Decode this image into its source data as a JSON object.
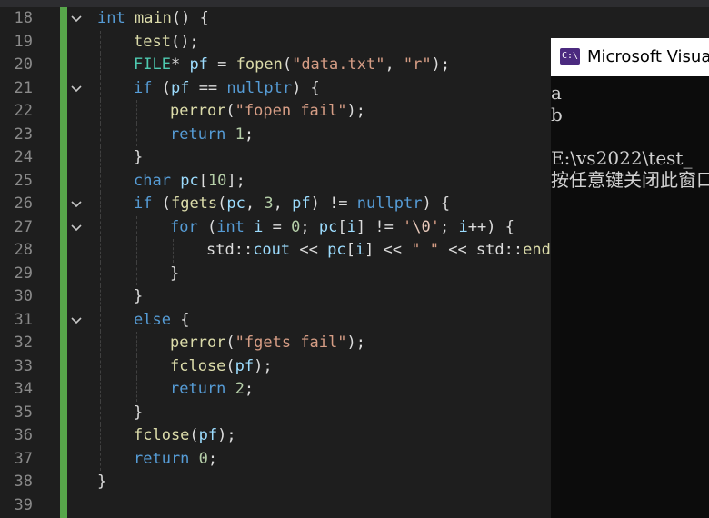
{
  "editor": {
    "lines": [
      {
        "n": "18",
        "indent": 0,
        "tokens": [
          [
            "kw",
            "int"
          ],
          [
            "t",
            " "
          ],
          [
            "fn",
            "main"
          ],
          [
            "t",
            "() {"
          ]
        ]
      },
      {
        "n": "19",
        "indent": 1,
        "tokens": [
          [
            "fn",
            "test"
          ],
          [
            "t",
            "();"
          ]
        ]
      },
      {
        "n": "20",
        "indent": 1,
        "tokens": [
          [
            "ty",
            "FILE"
          ],
          [
            "t",
            "* "
          ],
          [
            "vr",
            "pf"
          ],
          [
            "t",
            " = "
          ],
          [
            "fn",
            "fopen"
          ],
          [
            "t",
            "("
          ],
          [
            "str",
            "\"data.txt\""
          ],
          [
            "t",
            ", "
          ],
          [
            "str",
            "\"r\""
          ],
          [
            "t",
            ");"
          ]
        ]
      },
      {
        "n": "21",
        "indent": 1,
        "tokens": [
          [
            "kw",
            "if"
          ],
          [
            "t",
            " ("
          ],
          [
            "vr",
            "pf"
          ],
          [
            "t",
            " == "
          ],
          [
            "kw",
            "nullptr"
          ],
          [
            "t",
            ") {"
          ]
        ]
      },
      {
        "n": "22",
        "indent": 2,
        "tokens": [
          [
            "fn",
            "perror"
          ],
          [
            "t",
            "("
          ],
          [
            "str",
            "\"fopen fail\""
          ],
          [
            "t",
            ");"
          ]
        ]
      },
      {
        "n": "23",
        "indent": 2,
        "tokens": [
          [
            "kw",
            "return"
          ],
          [
            "t",
            " "
          ],
          [
            "num",
            "1"
          ],
          [
            "t",
            ";"
          ]
        ]
      },
      {
        "n": "24",
        "indent": 1,
        "tokens": [
          [
            "t",
            "}"
          ]
        ]
      },
      {
        "n": "25",
        "indent": 1,
        "tokens": [
          [
            "kw",
            "char"
          ],
          [
            "t",
            " "
          ],
          [
            "vr",
            "pc"
          ],
          [
            "t",
            "["
          ],
          [
            "num",
            "10"
          ],
          [
            "t",
            "];"
          ]
        ]
      },
      {
        "n": "26",
        "indent": 1,
        "tokens": [
          [
            "kw",
            "if"
          ],
          [
            "t",
            " ("
          ],
          [
            "fn",
            "fgets"
          ],
          [
            "t",
            "("
          ],
          [
            "vr",
            "pc"
          ],
          [
            "t",
            ", "
          ],
          [
            "num",
            "3"
          ],
          [
            "t",
            ", "
          ],
          [
            "vr",
            "pf"
          ],
          [
            "t",
            ") != "
          ],
          [
            "kw",
            "nullptr"
          ],
          [
            "t",
            ") {"
          ]
        ]
      },
      {
        "n": "27",
        "indent": 2,
        "tokens": [
          [
            "kw",
            "for"
          ],
          [
            "t",
            " ("
          ],
          [
            "kw",
            "int"
          ],
          [
            "t",
            " "
          ],
          [
            "vr",
            "i"
          ],
          [
            "t",
            " = "
          ],
          [
            "num",
            "0"
          ],
          [
            "t",
            "; "
          ],
          [
            "vr",
            "pc"
          ],
          [
            "t",
            "["
          ],
          [
            "vr",
            "i"
          ],
          [
            "t",
            "] != "
          ],
          [
            "str",
            "'"
          ],
          [
            "esc",
            "\\0"
          ],
          [
            "str",
            "'"
          ],
          [
            "t",
            "; "
          ],
          [
            "vr",
            "i"
          ],
          [
            "t",
            "++) {"
          ]
        ]
      },
      {
        "n": "28",
        "indent": 3,
        "tokens": [
          [
            "t",
            "std::"
          ],
          [
            "vr",
            "cout"
          ],
          [
            "t",
            " << "
          ],
          [
            "vr",
            "pc"
          ],
          [
            "t",
            "["
          ],
          [
            "vr",
            "i"
          ],
          [
            "t",
            "] << "
          ],
          [
            "str",
            "\" \""
          ],
          [
            "t",
            " << std::"
          ],
          [
            "fn",
            "endl"
          ]
        ]
      },
      {
        "n": "29",
        "indent": 2,
        "tokens": [
          [
            "t",
            "}"
          ]
        ]
      },
      {
        "n": "30",
        "indent": 1,
        "tokens": [
          [
            "t",
            "}"
          ]
        ]
      },
      {
        "n": "31",
        "indent": 1,
        "tokens": [
          [
            "kw",
            "else"
          ],
          [
            "t",
            " {"
          ]
        ]
      },
      {
        "n": "32",
        "indent": 2,
        "tokens": [
          [
            "fn",
            "perror"
          ],
          [
            "t",
            "("
          ],
          [
            "str",
            "\"fgets fail\""
          ],
          [
            "t",
            ");"
          ]
        ]
      },
      {
        "n": "33",
        "indent": 2,
        "tokens": [
          [
            "fn",
            "fclose"
          ],
          [
            "t",
            "("
          ],
          [
            "vr",
            "pf"
          ],
          [
            "t",
            ");"
          ]
        ]
      },
      {
        "n": "34",
        "indent": 2,
        "tokens": [
          [
            "kw",
            "return"
          ],
          [
            "t",
            " "
          ],
          [
            "num",
            "2"
          ],
          [
            "t",
            ";"
          ]
        ]
      },
      {
        "n": "35",
        "indent": 1,
        "tokens": [
          [
            "t",
            "}"
          ]
        ]
      },
      {
        "n": "36",
        "indent": 1,
        "tokens": [
          [
            "fn",
            "fclose"
          ],
          [
            "t",
            "("
          ],
          [
            "vr",
            "pf"
          ],
          [
            "t",
            ");"
          ]
        ]
      },
      {
        "n": "37",
        "indent": 1,
        "tokens": [
          [
            "kw",
            "return"
          ],
          [
            "t",
            " "
          ],
          [
            "num",
            "0"
          ],
          [
            "t",
            ";"
          ]
        ]
      },
      {
        "n": "38",
        "indent": 0,
        "tokens": [
          [
            "t",
            "}"
          ]
        ]
      },
      {
        "n": "39",
        "indent": 0,
        "tokens": []
      }
    ],
    "fold_lines": [
      "18",
      "21",
      "26",
      "27",
      "31"
    ]
  },
  "console": {
    "title": "Microsoft Visual Studio 调试控制台",
    "icon": "console-app-icon",
    "icon_text": "C:\\",
    "output": [
      "a",
      "b",
      "",
      "E:\\vs2022\\test_",
      "按任意键关闭此窗口"
    ]
  },
  "colors": {
    "keyword": "#569cd6",
    "function": "#dcdcaa",
    "type": "#4ec9b0",
    "string": "#d69d85",
    "number": "#b5cea8",
    "variable": "#9cdcfe",
    "change_bar": "#57a64a"
  }
}
